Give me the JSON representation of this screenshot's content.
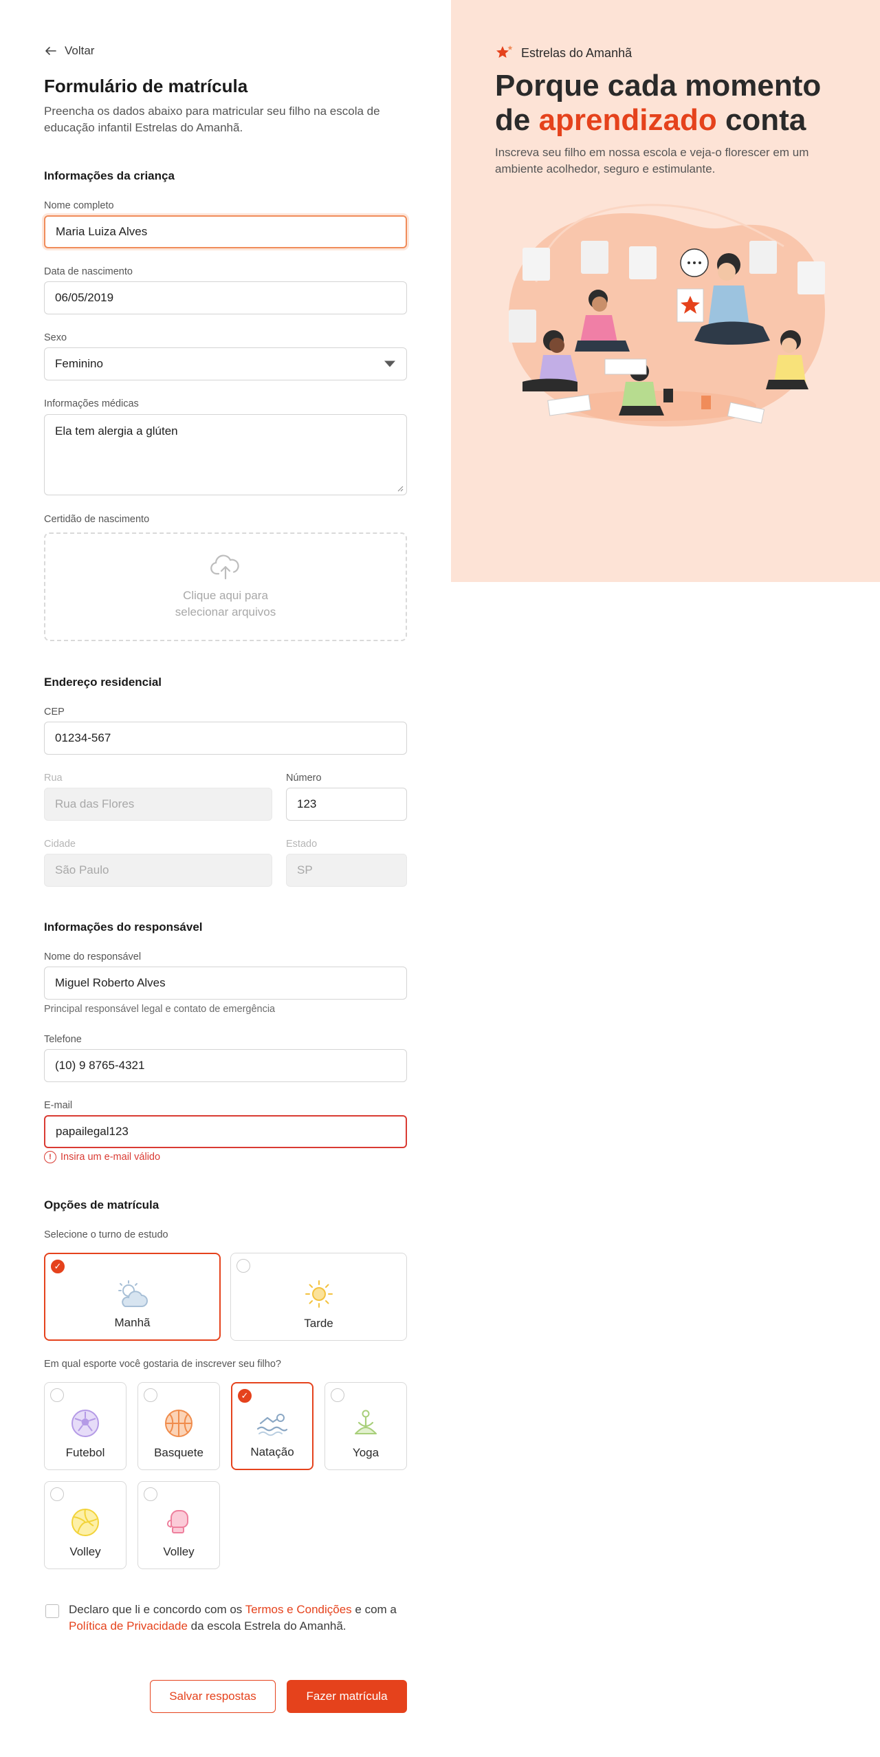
{
  "nav": {
    "back_label": "Voltar"
  },
  "form": {
    "title": "Formulário de matrícula",
    "subtitle": "Preencha os dados abaixo para matricular seu filho na escola de educação infantil Estrelas do Amanhã."
  },
  "child": {
    "section_title": "Informações da criança",
    "name_label": "Nome completo",
    "name_value": "Maria Luiza Alves",
    "birth_label": "Data de nascimento",
    "birth_value": "06/05/2019",
    "sex_label": "Sexo",
    "sex_value": "Feminino",
    "medical_label": "Informações médicas",
    "medical_value": "Ela tem alergia a glúten",
    "certificate_label": "Certidão de nascimento",
    "upload_text": "Clique aqui para selecionar arquivos"
  },
  "address": {
    "section_title": "Endereço residencial",
    "cep_label": "CEP",
    "cep_value": "01234-567",
    "street_label": "Rua",
    "street_value": "Rua das Flores",
    "number_label": "Número",
    "number_value": "123",
    "city_label": "Cidade",
    "city_value": "São Paulo",
    "state_label": "Estado",
    "state_value": "SP"
  },
  "guardian": {
    "section_title": "Informações do responsável",
    "name_label": "Nome do responsável",
    "name_value": "Miguel Roberto Alves",
    "name_helper": "Principal responsável legal e contato de emergência",
    "phone_label": "Telefone",
    "phone_value": "(10) 9 8765-4321",
    "email_label": "E-mail",
    "email_value": "papailegal123",
    "email_error": "Insira um e-mail válido"
  },
  "options": {
    "section_title": "Opções de matrícula",
    "shift_label": "Selecione o turno de estudo",
    "shifts": [
      {
        "name": "Manhã",
        "icon": "cloud-sun-icon",
        "selected": true
      },
      {
        "name": "Tarde",
        "icon": "sun-icon",
        "selected": false
      }
    ],
    "sport_label": "Em qual esporte você gostaria de inscrever seu filho?",
    "sports": [
      {
        "name": "Futebol",
        "icon": "soccer-ball-icon",
        "selected": false
      },
      {
        "name": "Basquete",
        "icon": "basketball-icon",
        "selected": false
      },
      {
        "name": "Natação",
        "icon": "swimmer-icon",
        "selected": true
      },
      {
        "name": "Yoga",
        "icon": "yoga-icon",
        "selected": false
      },
      {
        "name": "Volley",
        "icon": "volleyball-icon",
        "selected": false
      },
      {
        "name": "Volley",
        "icon": "boxing-glove-icon",
        "selected": false
      }
    ]
  },
  "terms": {
    "prefix": "Declaro que li e concordo com os ",
    "terms_link": "Termos e Condições",
    "middle": " e com a ",
    "privacy_link": "Política de Privacidade",
    "suffix": " da escola Estrela do Amanhã."
  },
  "actions": {
    "save_label": "Salvar respostas",
    "submit_label": "Fazer matrícula"
  },
  "hero": {
    "brand": "Estrelas do Amanhã",
    "title_part1": "Porque cada momento de ",
    "title_accent": "aprendizado",
    "title_part2": " conta",
    "subtitle": "Inscreva seu filho em nossa escola e veja-o florescer em um ambiente acolhedor, seguro e estimulante."
  },
  "colors": {
    "accent": "#e5421c",
    "hero_bg": "#fde3d6",
    "error": "#d93a32"
  }
}
